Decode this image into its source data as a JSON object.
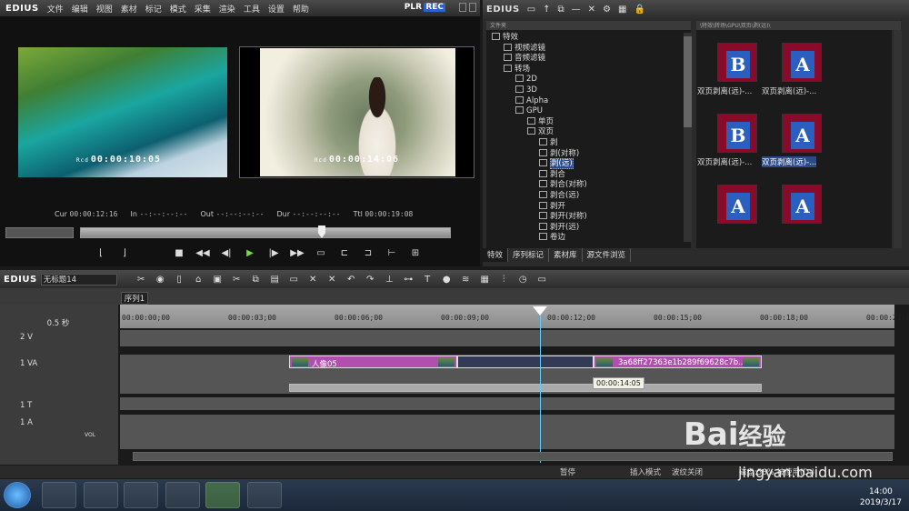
{
  "app": {
    "name": "EDIUS",
    "menu": [
      "文件",
      "编辑",
      "视图",
      "素材",
      "标记",
      "模式",
      "采集",
      "渲染",
      "工具",
      "设置",
      "帮助"
    ],
    "plr": "PLR",
    "rec": "REC"
  },
  "player": {
    "left_tc_label": "Rcd",
    "left_tc": "00:00:10:05",
    "right_tc_label": "Rcd",
    "right_tc": "00:00:14:06",
    "cur_label": "Cur",
    "cur": "00:00:12:16",
    "in_label": "In",
    "in": "--:--:--:--",
    "out_label": "Out",
    "out": "--:--:--:--",
    "dur_label": "Dur",
    "dur": "--:--:--:--",
    "ttl_label": "Ttl",
    "ttl": "00:00:19:08"
  },
  "right": {
    "title": "EDIUS",
    "tree_header": "文件夹",
    "thumb_header": "\\特效\\转场\\GPU\\双页\\剥(远)\\",
    "tree": [
      {
        "label": "特效",
        "indent": 0
      },
      {
        "label": "视频滤镜",
        "indent": 1
      },
      {
        "label": "音频滤镜",
        "indent": 1
      },
      {
        "label": "转场",
        "indent": 1
      },
      {
        "label": "2D",
        "indent": 2
      },
      {
        "label": "3D",
        "indent": 2
      },
      {
        "label": "Alpha",
        "indent": 2
      },
      {
        "label": "GPU",
        "indent": 2
      },
      {
        "label": "单页",
        "indent": 3
      },
      {
        "label": "双页",
        "indent": 3
      },
      {
        "label": "剥",
        "indent": 4
      },
      {
        "label": "剥(对称)",
        "indent": 4
      },
      {
        "label": "剥(远)",
        "indent": 4,
        "selected": true
      },
      {
        "label": "剥合",
        "indent": 4
      },
      {
        "label": "剥合(对称)",
        "indent": 4
      },
      {
        "label": "剥合(远)",
        "indent": 4
      },
      {
        "label": "剥开",
        "indent": 4
      },
      {
        "label": "剥开(对称)",
        "indent": 4
      },
      {
        "label": "剥开(远)",
        "indent": 4
      },
      {
        "label": "卷边",
        "indent": 4
      }
    ],
    "thumbs": [
      {
        "glyph": "B",
        "label": "双页剥离(远)-..."
      },
      {
        "glyph": "A",
        "label": "双页剥离(远)-..."
      },
      {
        "glyph": "B",
        "label": "双页剥离(远)-..."
      },
      {
        "glyph": "A",
        "label": "双页剥离(远)-...",
        "selected": true
      },
      {
        "glyph": "A",
        "label": ""
      },
      {
        "glyph": "A",
        "label": ""
      }
    ],
    "tabs": [
      "特效",
      "序列标记",
      "素材库",
      "源文件浏览"
    ]
  },
  "timeline": {
    "logo": "EDIUS",
    "project": "无标题14",
    "seq_tab": "序列1",
    "zoom": "0.5 秒",
    "ruler": [
      "00:00:00;00",
      "00:00:03;00",
      "00:00:06;00",
      "00:00:09;00",
      "00:00:12;00",
      "00:00:15;00",
      "00:00:18;00",
      "00:00:21;00"
    ],
    "tracks": [
      "2 V",
      "1 VA",
      "1 T",
      "1 A"
    ],
    "vol": "VOL",
    "clipA": "人像05",
    "clipC": "3a68ff27363e1b289f69628c7b...",
    "tooltip": "00:00:14:05"
  },
  "status": {
    "pause": "暂停",
    "insert": "插入模式",
    "ripple": "波纹关闭",
    "disk": "磁盘:58% 被使用(D:)"
  },
  "taskbar": {
    "time": "14:00",
    "date": "2019/3/17"
  },
  "watermark": {
    "brand": "Bai",
    "brand2": "经验",
    "url": "jingyan.baidu.com"
  }
}
